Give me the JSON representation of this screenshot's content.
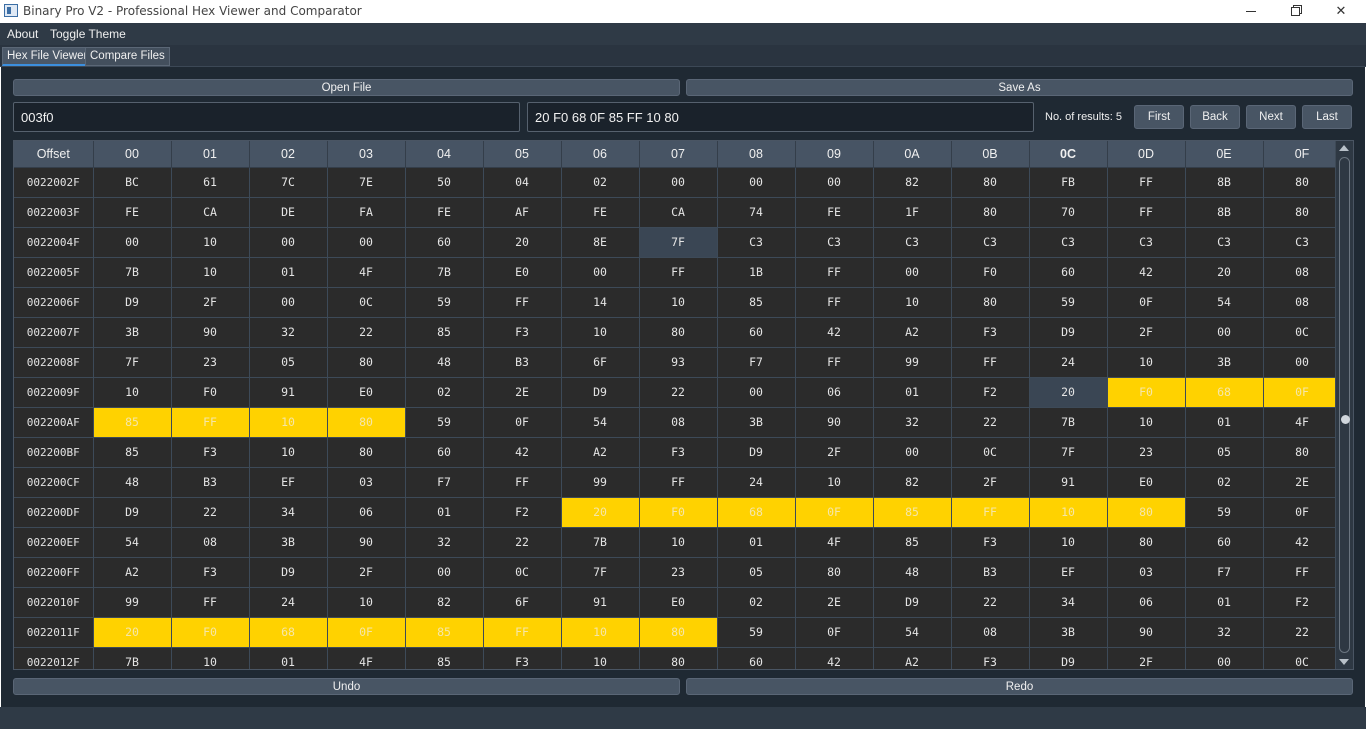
{
  "window": {
    "title": "Binary Pro V2 - Professional Hex Viewer and Comparator",
    "minimize": "—",
    "restore": "",
    "close": "✕"
  },
  "menu": {
    "about": "About",
    "toggle_theme": "Toggle Theme"
  },
  "tabs": [
    {
      "label": "Hex File Viewer",
      "active": true
    },
    {
      "label": "Compare Files",
      "active": false
    }
  ],
  "toolbar": {
    "open_file": "Open File",
    "save_as": "Save As"
  },
  "search": {
    "offset_value": "003f0",
    "pattern_value": "20 F0 68 0F 85 FF 10 80",
    "results_label": "No. of results: 5",
    "first": "First",
    "back": "Back",
    "next": "Next",
    "last": "Last"
  },
  "table": {
    "headers": [
      "Offset",
      "00",
      "01",
      "02",
      "03",
      "04",
      "05",
      "06",
      "07",
      "08",
      "09",
      "0A",
      "0B",
      "0C",
      "0D",
      "0E",
      "0F"
    ],
    "bold_header": "0C",
    "rows": [
      {
        "offset": "0022002F",
        "bytes": [
          "BC",
          "61",
          "7C",
          "7E",
          "50",
          "04",
          "02",
          "00",
          "00",
          "00",
          "82",
          "80",
          "FB",
          "FF",
          "8B",
          "80"
        ]
      },
      {
        "offset": "0022003F",
        "bytes": [
          "FE",
          "CA",
          "DE",
          "FA",
          "FE",
          "AF",
          "FE",
          "CA",
          "74",
          "FE",
          "1F",
          "80",
          "70",
          "FF",
          "8B",
          "80"
        ]
      },
      {
        "offset": "0022004F",
        "bytes": [
          "00",
          "10",
          "00",
          "00",
          "60",
          "20",
          "8E",
          "7F",
          "C3",
          "C3",
          "C3",
          "C3",
          "C3",
          "C3",
          "C3",
          "C3"
        ]
      },
      {
        "offset": "0022005F",
        "bytes": [
          "7B",
          "10",
          "01",
          "4F",
          "7B",
          "E0",
          "00",
          "FF",
          "1B",
          "FF",
          "00",
          "F0",
          "60",
          "42",
          "20",
          "08"
        ]
      },
      {
        "offset": "0022006F",
        "bytes": [
          "D9",
          "2F",
          "00",
          "0C",
          "59",
          "FF",
          "14",
          "10",
          "85",
          "FF",
          "10",
          "80",
          "59",
          "0F",
          "54",
          "08"
        ]
      },
      {
        "offset": "0022007F",
        "bytes": [
          "3B",
          "90",
          "32",
          "22",
          "85",
          "F3",
          "10",
          "80",
          "60",
          "42",
          "A2",
          "F3",
          "D9",
          "2F",
          "00",
          "0C"
        ]
      },
      {
        "offset": "0022008F",
        "bytes": [
          "7F",
          "23",
          "05",
          "80",
          "48",
          "B3",
          "6F",
          "93",
          "F7",
          "FF",
          "99",
          "FF",
          "24",
          "10",
          "3B",
          "00"
        ]
      },
      {
        "offset": "0022009F",
        "bytes": [
          "10",
          "F0",
          "91",
          "E0",
          "02",
          "2E",
          "D9",
          "22",
          "00",
          "06",
          "01",
          "F2",
          "20",
          "F0",
          "68",
          "0F"
        ]
      },
      {
        "offset": "002200AF",
        "bytes": [
          "85",
          "FF",
          "10",
          "80",
          "59",
          "0F",
          "54",
          "08",
          "3B",
          "90",
          "32",
          "22",
          "7B",
          "10",
          "01",
          "4F"
        ]
      },
      {
        "offset": "002200BF",
        "bytes": [
          "85",
          "F3",
          "10",
          "80",
          "60",
          "42",
          "A2",
          "F3",
          "D9",
          "2F",
          "00",
          "0C",
          "7F",
          "23",
          "05",
          "80"
        ]
      },
      {
        "offset": "002200CF",
        "bytes": [
          "48",
          "B3",
          "EF",
          "03",
          "F7",
          "FF",
          "99",
          "FF",
          "24",
          "10",
          "82",
          "2F",
          "91",
          "E0",
          "02",
          "2E"
        ]
      },
      {
        "offset": "002200DF",
        "bytes": [
          "D9",
          "22",
          "34",
          "06",
          "01",
          "F2",
          "20",
          "F0",
          "68",
          "0F",
          "85",
          "FF",
          "10",
          "80",
          "59",
          "0F"
        ]
      },
      {
        "offset": "002200EF",
        "bytes": [
          "54",
          "08",
          "3B",
          "90",
          "32",
          "22",
          "7B",
          "10",
          "01",
          "4F",
          "85",
          "F3",
          "10",
          "80",
          "60",
          "42"
        ]
      },
      {
        "offset": "002200FF",
        "bytes": [
          "A2",
          "F3",
          "D9",
          "2F",
          "00",
          "0C",
          "7F",
          "23",
          "05",
          "80",
          "48",
          "B3",
          "EF",
          "03",
          "F7",
          "FF"
        ]
      },
      {
        "offset": "0022010F",
        "bytes": [
          "99",
          "FF",
          "24",
          "10",
          "82",
          "6F",
          "91",
          "E0",
          "02",
          "2E",
          "D9",
          "22",
          "34",
          "06",
          "01",
          "F2"
        ]
      },
      {
        "offset": "0022011F",
        "bytes": [
          "20",
          "F0",
          "68",
          "0F",
          "85",
          "FF",
          "10",
          "80",
          "59",
          "0F",
          "54",
          "08",
          "3B",
          "90",
          "32",
          "22"
        ]
      },
      {
        "offset": "0022012F",
        "bytes": [
          "7B",
          "10",
          "01",
          "4F",
          "85",
          "F3",
          "10",
          "80",
          "60",
          "42",
          "A2",
          "F3",
          "D9",
          "2F",
          "00",
          "0C"
        ]
      }
    ],
    "highlights": [
      [
        7,
        13
      ],
      [
        7,
        14
      ],
      [
        7,
        15
      ],
      [
        8,
        0
      ],
      [
        8,
        1
      ],
      [
        8,
        2
      ],
      [
        8,
        3
      ],
      [
        11,
        6
      ],
      [
        11,
        7
      ],
      [
        11,
        8
      ],
      [
        11,
        9
      ],
      [
        11,
        10
      ],
      [
        11,
        11
      ],
      [
        11,
        12
      ],
      [
        11,
        13
      ],
      [
        15,
        0
      ],
      [
        15,
        1
      ],
      [
        15,
        2
      ],
      [
        15,
        3
      ],
      [
        15,
        4
      ],
      [
        15,
        5
      ],
      [
        15,
        6
      ],
      [
        15,
        7
      ]
    ],
    "selected": [
      [
        2,
        7
      ],
      [
        7,
        12
      ]
    ]
  },
  "scrollbar": {
    "position": 0.53
  },
  "history": {
    "undo": "Undo",
    "redo": "Redo"
  },
  "colors": {
    "highlight": "#ffd200",
    "panel": "#1f2933",
    "header": "#475464",
    "accent": "#3c8fde"
  }
}
